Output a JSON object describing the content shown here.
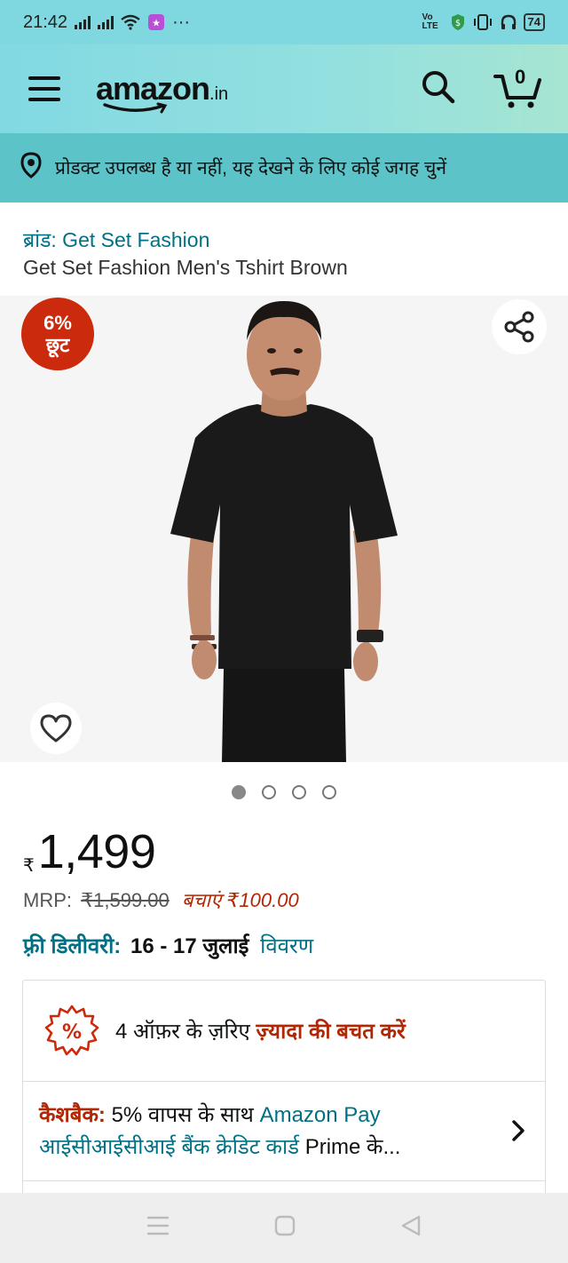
{
  "status_bar": {
    "time": "21:42",
    "more": "···",
    "volte": "Vo LTE",
    "battery": "74"
  },
  "header": {
    "logo_text": "amazon",
    "logo_suffix": ".in",
    "cart_count": "0"
  },
  "location": {
    "text": "प्रोडक्ट उपलब्ध है या नहीं, यह देखने के लिए कोई जगह चुनें"
  },
  "product": {
    "brand_label": "ब्रांड: Get Set Fashion",
    "title": "Get Set Fashion Men's Tshirt Brown",
    "discount_percent": "6%",
    "discount_word": "छूट",
    "image_count": 4,
    "active_image": 0
  },
  "price": {
    "currency_symbol": "₹",
    "amount": "1,499",
    "mrp_label": "MRP:",
    "mrp_value": "₹1,599.00",
    "savings": "बचाएं ₹100.00"
  },
  "delivery": {
    "label": "फ़्री डिलीवरी:",
    "dates": "16 - 17 जुलाई",
    "details_link": "विवरण"
  },
  "offers": {
    "lead": "4 ऑफ़र के ज़रिए",
    "highlight": "ज़्यादा की बचत करें",
    "cashback_label": "कैशबैक:",
    "cashback_text": "5% वापस के साथ",
    "cashback_link": "Amazon Pay आईसीआईसीआई बैंक क्रेडिट कार्ड",
    "cashback_tail": "Prime के..."
  },
  "colors": {
    "header_teal": "#86d9e0",
    "location_teal": "#5cc3c9",
    "link": "#007185",
    "deal_red": "#b12704",
    "badge_red": "#cc2a0c"
  }
}
